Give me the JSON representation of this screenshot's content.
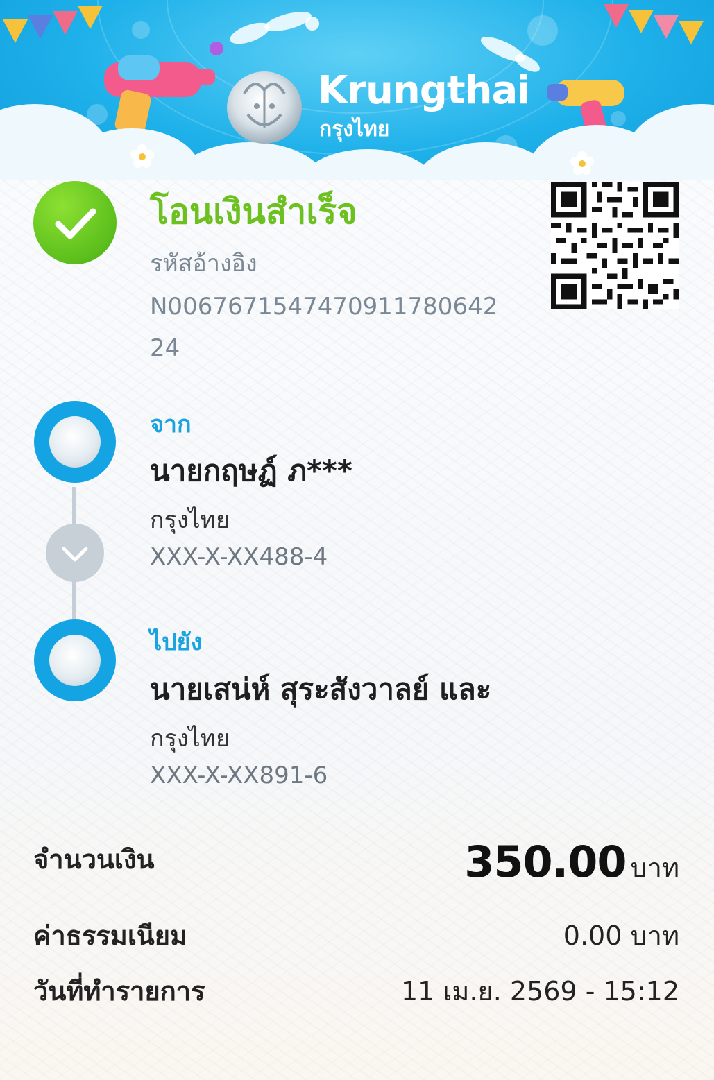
{
  "brand": {
    "name_en": "Krungthai",
    "name_th": "กรุงไทย"
  },
  "status": {
    "title": "โอนเงินสำเร็จ",
    "ref_label": "รหัสอ้างอิง",
    "ref_value": "N006767154747091178064224",
    "icon": "check-icon"
  },
  "from": {
    "role": "จาก",
    "name": "นายกฤษฏ์ ภ***",
    "bank": "กรุงไทย",
    "account": "XXX-X-XX488-4"
  },
  "to": {
    "role": "ไปยัง",
    "name": "นายเสน่ห์ สุระสังวาลย์ และ",
    "bank": "กรุงไทย",
    "account": "XXX-X-XX891-6"
  },
  "summary": {
    "amount_label": "จำนวนเงิน",
    "amount_value": "350.00",
    "amount_unit": "บาท",
    "fee_label": "ค่าธรรมเนียม",
    "fee_value": "0.00 บาท",
    "date_label": "วันที่ทำรายการ",
    "date_value": "11 เม.ย. 2569 - 15:12"
  },
  "colors": {
    "success_green": "#6cc01f",
    "brand_blue": "#1aa3e0",
    "banner_blue": "#1fb1ea"
  }
}
